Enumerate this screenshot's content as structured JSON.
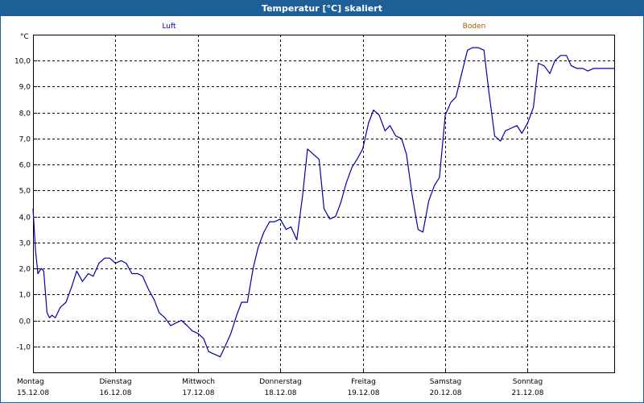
{
  "window": {
    "title": "Temperatur [°C] skaliert"
  },
  "colors": {
    "titlebar": "#1f5f98",
    "luft": "#0000aa",
    "boden": "#a05a00",
    "grid": "#000000"
  },
  "chart_data": {
    "type": "line",
    "title": "Temperatur [°C] skaliert",
    "ylabel": "°C",
    "xlabel": "",
    "ylim": [
      -2.0,
      11.0
    ],
    "xlim": [
      0,
      7.05
    ],
    "grid": true,
    "legend_placement": "top",
    "yticks": [
      {
        "value": -1.0,
        "label": "-1,0"
      },
      {
        "value": 0.0,
        "label": "0,0"
      },
      {
        "value": 1.0,
        "label": "1,0"
      },
      {
        "value": 2.0,
        "label": "2,0"
      },
      {
        "value": 3.0,
        "label": "3,0"
      },
      {
        "value": 4.0,
        "label": "4,0"
      },
      {
        "value": 5.0,
        "label": "5,0"
      },
      {
        "value": 6.0,
        "label": "6,0"
      },
      {
        "value": 7.0,
        "label": "7,0"
      },
      {
        "value": 8.0,
        "label": "8,0"
      },
      {
        "value": 9.0,
        "label": "9,0"
      },
      {
        "value": 10.0,
        "label": "10,0"
      }
    ],
    "xticks": [
      {
        "value": 0,
        "day": "Montag",
        "date": "15.12.08"
      },
      {
        "value": 1,
        "day": "Dienstag",
        "date": "16.12.08"
      },
      {
        "value": 2,
        "day": "Mittwoch",
        "date": "17.12.08"
      },
      {
        "value": 3,
        "day": "Donnerstag",
        "date": "18.12.08"
      },
      {
        "value": 4,
        "day": "Freitag",
        "date": "19.12.08"
      },
      {
        "value": 5,
        "day": "Samstag",
        "date": "20.12.08"
      },
      {
        "value": 6,
        "day": "Sonntag",
        "date": "21.12.08"
      }
    ],
    "series": [
      {
        "name": "Luft",
        "color": "#0000aa",
        "x": [
          0,
          0.03,
          0.06,
          0.1,
          0.13,
          0.17,
          0.2,
          0.23,
          0.27,
          0.33,
          0.4,
          0.47,
          0.53,
          0.6,
          0.67,
          0.73,
          0.8,
          0.87,
          0.93,
          1.0,
          1.07,
          1.13,
          1.2,
          1.27,
          1.33,
          1.4,
          1.47,
          1.53,
          1.6,
          1.67,
          1.73,
          1.8,
          1.87,
          1.93,
          2.0,
          2.07,
          2.13,
          2.2,
          2.27,
          2.33,
          2.4,
          2.47,
          2.53,
          2.6,
          2.67,
          2.73,
          2.8,
          2.87,
          2.93,
          3.0,
          3.07,
          3.13,
          3.2,
          3.27,
          3.33,
          3.4,
          3.47,
          3.53,
          3.6,
          3.67,
          3.73,
          3.8,
          3.87,
          3.93,
          4.0,
          4.07,
          4.13,
          4.2,
          4.27,
          4.33,
          4.4,
          4.47,
          4.53,
          4.6,
          4.67,
          4.73,
          4.8,
          4.87,
          4.93,
          5.0,
          5.07,
          5.13,
          5.2,
          5.27,
          5.33,
          5.4,
          5.47,
          5.53,
          5.6,
          5.67,
          5.73,
          5.8,
          5.87,
          5.93,
          6.0,
          6.07,
          6.13,
          6.2,
          6.27,
          6.33,
          6.4,
          6.47,
          6.53,
          6.6,
          6.67,
          6.73,
          6.8,
          6.87,
          6.93,
          7.0,
          7.05
        ],
        "values": [
          4.3,
          2.7,
          1.8,
          2.0,
          1.9,
          0.3,
          0.1,
          0.2,
          0.1,
          0.5,
          0.7,
          1.3,
          1.9,
          1.5,
          1.8,
          1.7,
          2.2,
          2.4,
          2.4,
          2.2,
          2.3,
          2.2,
          1.8,
          1.8,
          1.7,
          1.2,
          0.8,
          0.3,
          0.1,
          -0.2,
          -0.1,
          0.0,
          -0.2,
          -0.4,
          -0.5,
          -0.7,
          -1.2,
          -1.3,
          -1.4,
          -1.0,
          -0.5,
          0.2,
          0.7,
          0.7,
          2.0,
          2.8,
          3.4,
          3.8,
          3.8,
          3.9,
          3.5,
          3.6,
          3.1,
          4.8,
          6.6,
          6.4,
          6.2,
          4.3,
          3.9,
          4.0,
          4.5,
          5.3,
          5.9,
          6.2,
          6.6,
          7.6,
          8.1,
          7.9,
          7.3,
          7.5,
          7.1,
          7.0,
          6.4,
          4.8,
          3.5,
          3.4,
          4.6,
          5.2,
          5.5,
          7.9,
          8.4,
          8.6,
          9.5,
          10.4,
          10.5,
          10.5,
          10.4,
          8.8,
          7.1,
          6.9,
          7.3,
          7.4,
          7.5,
          7.2,
          7.6,
          8.2,
          9.9,
          9.8,
          9.5,
          10.0,
          10.2,
          10.2,
          9.8,
          9.7,
          9.7,
          9.6,
          9.7,
          9.7,
          9.7,
          9.7,
          9.7
        ]
      },
      {
        "name": "Boden",
        "color": "#a05a00",
        "x": [],
        "values": []
      }
    ]
  }
}
